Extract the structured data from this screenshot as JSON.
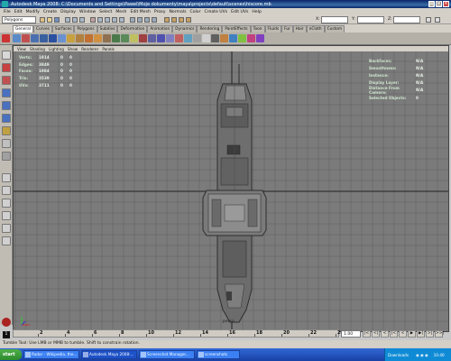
{
  "window": {
    "title": "Autodesk Maya 2008: C:\\Documents and Settings\\Pawel\\Moje dokumenty\\maya\\projects\\default\\scenes\\hiscore.mb"
  },
  "menu": [
    "File",
    "Edit",
    "Modify",
    "Create",
    "Display",
    "Window",
    "Select",
    "Mesh",
    "Edit Mesh",
    "Proxy",
    "Normals",
    "Color",
    "Create UVs",
    "Edit UVs",
    "Help"
  ],
  "status_line": {
    "mode": "Polygons",
    "x_label": "X:",
    "y_label": "Y:",
    "z_label": "Z:"
  },
  "shelf_tabs": [
    {
      "label": "General",
      "active": true
    },
    {
      "label": "Curves",
      "active": false
    },
    {
      "label": "Surfaces",
      "active": false
    },
    {
      "label": "Polygons",
      "active": false
    },
    {
      "label": "Subdivs",
      "active": false
    },
    {
      "label": "Deformation",
      "active": false
    },
    {
      "label": "Animation",
      "active": false
    },
    {
      "label": "Dynamics",
      "active": false
    },
    {
      "label": "Rendering",
      "active": false
    },
    {
      "label": "PaintEffects",
      "active": false
    },
    {
      "label": "Toon",
      "active": false
    },
    {
      "label": "Fluids",
      "active": false
    },
    {
      "label": "Fur",
      "active": false
    },
    {
      "label": "Hair",
      "active": false
    },
    {
      "label": "nCloth",
      "active": false
    },
    {
      "label": "Custom",
      "active": false
    }
  ],
  "panel_menu": [
    "View",
    "Shading",
    "Lighting",
    "Show",
    "Renderer",
    "Panels"
  ],
  "hud_poly": [
    {
      "label": "Verts:",
      "total": "1914",
      "sel": "0",
      "comp": "0"
    },
    {
      "label": "Edges:",
      "total": "3849",
      "sel": "0",
      "comp": "0"
    },
    {
      "label": "Faces:",
      "total": "1984",
      "sel": "0",
      "comp": "0"
    },
    {
      "label": "Tris:",
      "total": "3539",
      "sel": "0",
      "comp": "0"
    },
    {
      "label": "UVs:",
      "total": "3711",
      "sel": "0",
      "comp": "0"
    }
  ],
  "hud_right": [
    {
      "label": "Backfaces:",
      "value": "N/A"
    },
    {
      "label": "Smoothness:",
      "value": "N/A"
    },
    {
      "label": "Instance:",
      "value": "N/A"
    },
    {
      "label": "Display Layer:",
      "value": "N/A"
    },
    {
      "label": "Distance From Camera:",
      "value": "N/A"
    },
    {
      "label": "Selected Objects:",
      "value": "0"
    }
  ],
  "camera_label": "persp",
  "timeslider": {
    "ticks": [
      "2",
      "4",
      "6",
      "8",
      "10",
      "12",
      "14",
      "16",
      "18",
      "20",
      "22",
      "24"
    ],
    "current_frame": "1",
    "current_frame_field": "1.00"
  },
  "playback_buttons": [
    "|<",
    "<|",
    "<",
    "|<",
    "<",
    "▶",
    "▶|",
    ">|",
    ">>|"
  ],
  "help_line": "Tumble Tool: Use LMB or MMB to tumble. Shift to constrain rotation.",
  "taskbar": {
    "start_label": "start",
    "tasks": [
      {
        "label": "Radar - Wikipedia, the...",
        "active": false
      },
      {
        "label": "Autodesk Maya 2008:...",
        "active": true
      },
      {
        "label": "Screenshot Manager...",
        "active": false
      },
      {
        "label": "screenshots",
        "active": false
      }
    ],
    "tray_label": "Downloads",
    "clock": "10:40"
  },
  "colors": {
    "viewport_bg": "#7b7b7b",
    "grid": "#5f5f5f",
    "hud_text": "#e8f0e8"
  }
}
